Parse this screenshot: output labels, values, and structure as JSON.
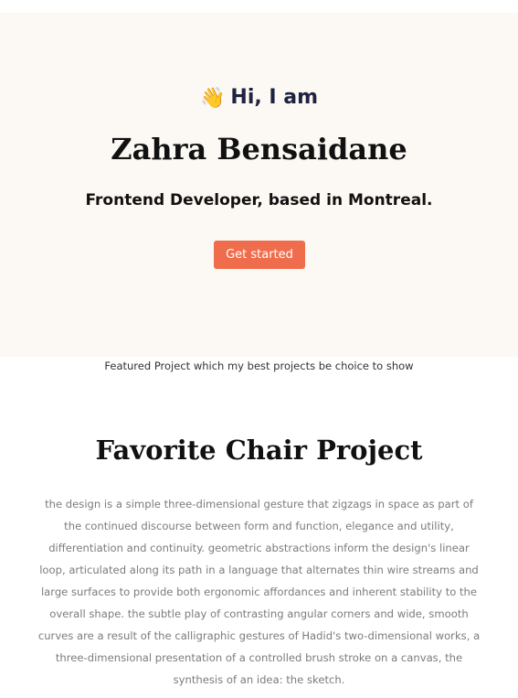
{
  "hero": {
    "wave_icon": "👋",
    "wave_icon_name": "waving-hand-icon",
    "greeting": "Hi, I am",
    "name": "Zahra Bensaidane",
    "role": "Frontend Developer, based in Montreal.",
    "cta_label": "Get started"
  },
  "featured": {
    "note": "Featured Project which my best projects be choice to show"
  },
  "project": {
    "title": "Favorite Chair Project",
    "description": "the design is a simple three-dimensional gesture that zigzags in space as part of the continued discourse between form and function, elegance and utility, differentiation and continuity. geometric abstractions inform the design's linear loop, articulated along its path in a language that alternates thin wire streams and large surfaces to provide both ergonomic affordances and inherent stability to the overall shape. the subtle play of contrasting angular corners and wide, smooth curves are a result of the calligraphic gestures of Hadid's two-dimensional works, a three-dimensional presentation of a controlled brush stroke on a canvas, the synthesis of an idea: the sketch."
  },
  "colors": {
    "hero_background": "#fcf8f3",
    "accent": "#ef6d4c",
    "body_text": "#7c7c7c"
  }
}
